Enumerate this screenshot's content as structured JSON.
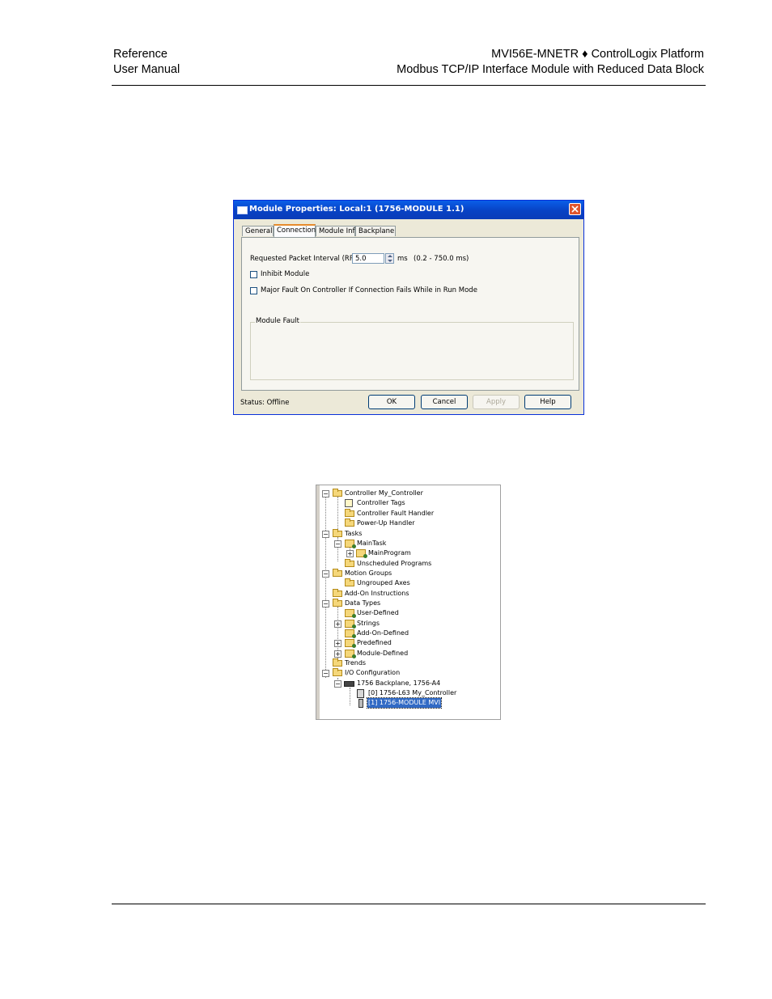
{
  "header": {
    "left_line1": "Reference",
    "left_line2": "User Manual",
    "right_line1": "MVI56E-MNETR ♦ ControlLogix Platform",
    "right_line2": "Modbus TCP/IP Interface Module with Reduced Data Block"
  },
  "dialog": {
    "title": "Module Properties: Local:1 (1756-MODULE 1.1)",
    "tabs": [
      "General",
      "Connection",
      "Module Info",
      "Backplane"
    ],
    "active_tab": "Connection",
    "rpi_label": "Requested Packet Interval (RPI):",
    "rpi_value": "5.0",
    "rpi_unit": "ms",
    "rpi_range": "(0.2 - 750.0 ms)",
    "inhibit_label": "Inhibit Module",
    "inhibit_checked": false,
    "major_fault_label": "Major Fault On Controller If Connection Fails While in Run Mode",
    "major_fault_checked": false,
    "module_fault_legend": "Module Fault",
    "status": "Status:  Offline",
    "buttons": {
      "ok": "OK",
      "cancel": "Cancel",
      "apply": "Apply",
      "help": "Help"
    }
  },
  "tree": {
    "items": [
      "Controller My_Controller",
      "Controller Tags",
      "Controller Fault Handler",
      "Power-Up Handler",
      "Tasks",
      "MainTask",
      "MainProgram",
      "Unscheduled Programs",
      "Motion Groups",
      "Ungrouped Axes",
      "Add-On Instructions",
      "Data Types",
      "User-Defined",
      "Strings",
      "Add-On-Defined",
      "Predefined",
      "Module-Defined",
      "Trends",
      "I/O Configuration",
      "1756 Backplane, 1756-A4",
      "[0] 1756-L63 My_Controller",
      "[1] 1756-MODULE MVI"
    ],
    "selected_item": "[1] 1756-MODULE MVI"
  },
  "colors": {
    "titlebar_blue": "#0842c4",
    "dialog_face": "#ece9d8",
    "selection_blue": "#316ac5",
    "folder_yellow": "#f5d77a",
    "close_red": "#e0552d"
  }
}
